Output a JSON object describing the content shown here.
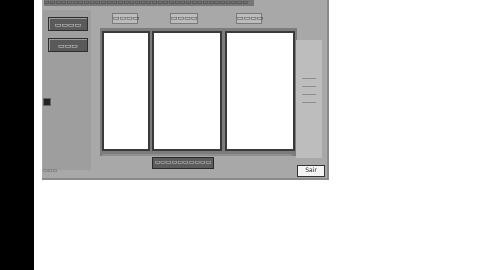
{
  "app": {
    "title": "▭▭▭▭▭▭▭▭▭▭▭▭▭▭▭▭▭▭▭▭▭▭▭▭▭▭▭▭▭▭▭▭▭▭▭▭"
  },
  "sidebar": {
    "buttons": [
      {
        "label": "▭▭▭▭"
      },
      {
        "label": "▭▭▭"
      }
    ]
  },
  "columns": [
    {
      "header": "▭▭▭▭"
    },
    {
      "header": "▭▭▭▭"
    },
    {
      "header": "▭▭▭▭"
    }
  ],
  "footer": {
    "action_label": "▭▭▭▭▭▭▭▭▭▭",
    "ok_label": "Sair",
    "status": "▭▭▭"
  },
  "colors": {
    "window_bg": "#a8a8a8",
    "panel_bg": "#ffffff",
    "button_bg": "#5a5a5a",
    "page_bg": "#ffffff"
  }
}
